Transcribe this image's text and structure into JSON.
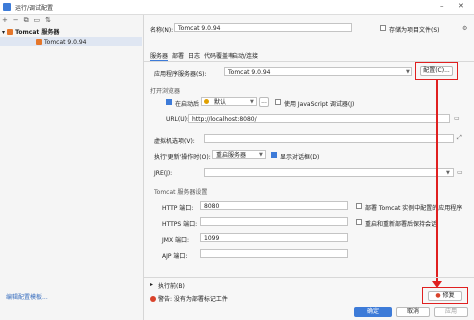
{
  "window": {
    "title": "运行/调试配置"
  },
  "sidebar": {
    "group_label": "Tomcat 服务器",
    "selected_item": "Tomcat 9.0.94",
    "edit_templates_link": "编辑配置模板..."
  },
  "form": {
    "name_label": "名称(N):",
    "name_value": "Tomcat 9.0.94",
    "store_as_project_label": "存储为项目文件(S)",
    "tabs": [
      "服务器",
      "部署",
      "日志",
      "代码覆盖率",
      "启动/连接"
    ],
    "app_server_label": "应用程序服务器(S):",
    "app_server_value": "Tomcat 9.0.94",
    "configure_button": "配置(C)...",
    "open_browser_section": "打开浏览器",
    "after_launch_label": "在启动后",
    "browser_value": "默认",
    "browser_more": "...",
    "js_debugger_label": "使用 JavaScript 调试器(J)",
    "url_label": "URL(U):",
    "url_value": "http://localhost:8080/",
    "vm_options_label": "虚拟机选项(V):",
    "update_action_label": "执行'更新'操作时(O):",
    "update_action_value": "重启服务器",
    "show_dialog_label": "显示对话框(D)",
    "jre_label": "JRE(J):",
    "tomcat_settings_section": "Tomcat 服务器设置",
    "http_port_label": "HTTP 端口:",
    "http_port_value": "8080",
    "https_port_label": "HTTPS 端口:",
    "https_port_value": "",
    "jmx_port_label": "JMX 端口:",
    "jmx_port_value": "1099",
    "ajp_port_label": "AJP 端口:",
    "ajp_port_value": "",
    "deploy_in_tomcat_label": "部署 Tomcat 实例中配置的应用程序",
    "preserve_sessions_label": "重启和重新部署后保持会话"
  },
  "footer": {
    "before_launch_label": "执行前(B)",
    "warning_text": "警告: 没有为部署标记工件",
    "fix_button": "修复",
    "ok_button": "确定",
    "cancel_button": "取消",
    "apply_button": "应用"
  },
  "colors": {
    "accent": "#3d7bd8",
    "highlight_red": "#e02020"
  }
}
